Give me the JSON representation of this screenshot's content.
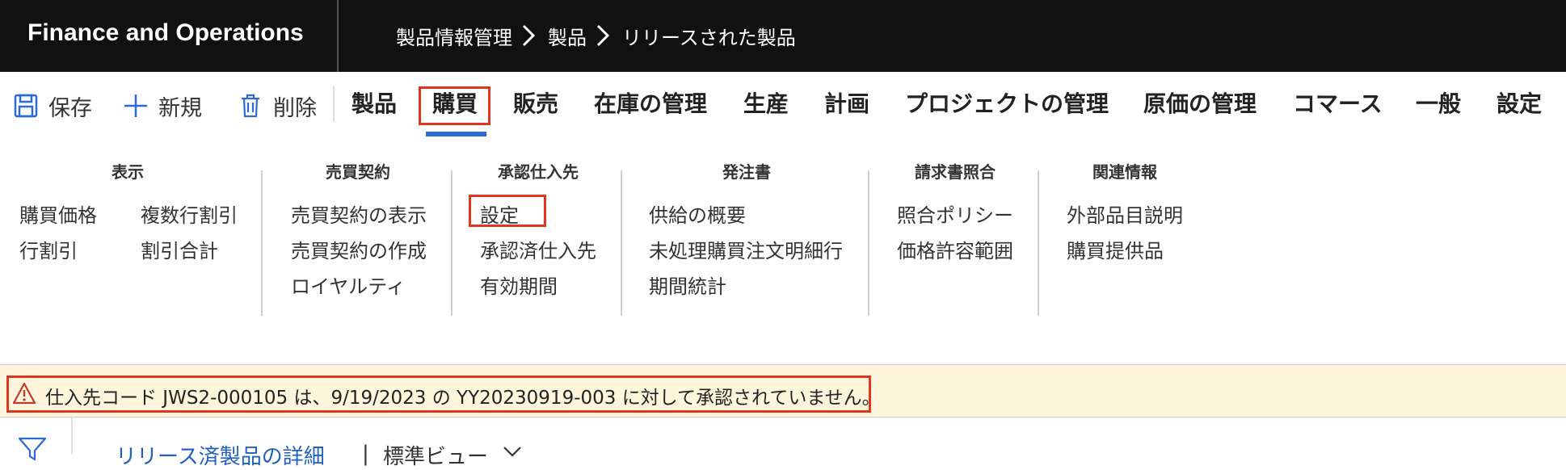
{
  "app": {
    "title": "Finance and Operations"
  },
  "breadcrumb": [
    "製品情報管理",
    "製品",
    "リリースされた製品"
  ],
  "toolbar": {
    "save_label": "保存",
    "new_label": "新規",
    "delete_label": "削除"
  },
  "tabs": [
    {
      "label": "製品"
    },
    {
      "label": "購買",
      "selected": true
    },
    {
      "label": "販売"
    },
    {
      "label": "在庫の管理"
    },
    {
      "label": "生産"
    },
    {
      "label": "計画"
    },
    {
      "label": "プロジェクトの管理"
    },
    {
      "label": "原価の管理"
    },
    {
      "label": "コマース"
    },
    {
      "label": "一般"
    },
    {
      "label": "設定"
    }
  ],
  "ribbon": {
    "groups": [
      {
        "title": "表示",
        "items": [
          "購買価格",
          "行割引",
          "複数行割引",
          "割引合計"
        ]
      },
      {
        "title": "売買契約",
        "items": [
          "売買契約の表示",
          "売買契約の作成",
          "ロイヤルティ"
        ]
      },
      {
        "title": "承認仕入先",
        "items": [
          "設定",
          "承認済仕入先",
          "有効期間"
        ]
      },
      {
        "title": "発注書",
        "items": [
          "供給の概要",
          "未処理購買注文明細行",
          "期間統計"
        ]
      },
      {
        "title": "請求書照合",
        "items": [
          "照合ポリシー",
          "価格許容範囲"
        ]
      },
      {
        "title": "関連情報",
        "items": [
          "外部品目説明",
          "購買提供品"
        ]
      }
    ]
  },
  "warning": {
    "message": "仕入先コード JWS2-000105 は、9/19/2023 の YY20230919-003 に対して承認されていません。"
  },
  "bottom": {
    "link_label": "リリース済製品の詳細",
    "separator": "|",
    "view_label": "標準ビュー"
  },
  "colors": {
    "topbar_bg": "#111111",
    "highlight_border": "#e0351f",
    "selected_tab_underline": "#2c6bd6",
    "warning_bg": "#fdf6dc",
    "link": "#1f5fbf"
  }
}
